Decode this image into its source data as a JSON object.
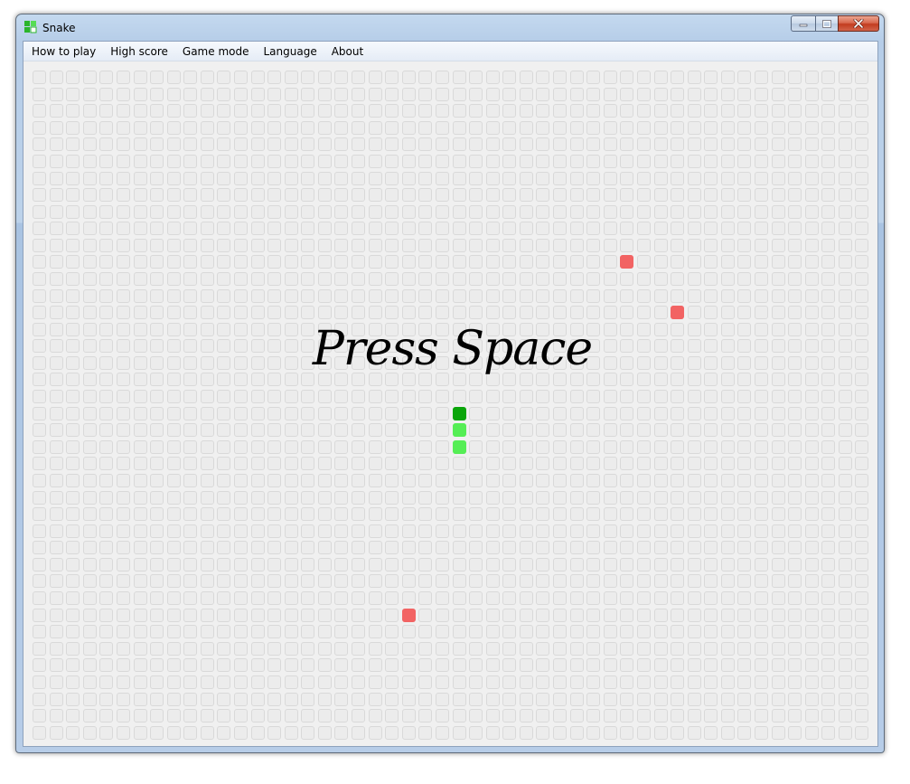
{
  "window": {
    "title": "Snake",
    "icon": "snake-app-icon",
    "buttons": [
      "minimize",
      "maximize",
      "close"
    ]
  },
  "menu": [
    {
      "label": "How to play"
    },
    {
      "label": "High score"
    },
    {
      "label": "Game mode"
    },
    {
      "label": "Language"
    },
    {
      "label": "About"
    }
  ],
  "game": {
    "message": "Press Space",
    "grid": {
      "columns": 50,
      "rows": 40
    },
    "snake": {
      "head": {
        "col": 25,
        "row": 20
      },
      "body": [
        {
          "col": 25,
          "row": 21
        },
        {
          "col": 25,
          "row": 22
        }
      ]
    },
    "food": [
      {
        "col": 35,
        "row": 11
      },
      {
        "col": 38,
        "row": 14
      },
      {
        "col": 22,
        "row": 32
      }
    ],
    "colors": {
      "cell_fill": "#ececec",
      "cell_border": "#d9d9d9",
      "snake_head": "#0aa50a",
      "snake_body": "#55ee55",
      "food": "#f26363"
    }
  }
}
